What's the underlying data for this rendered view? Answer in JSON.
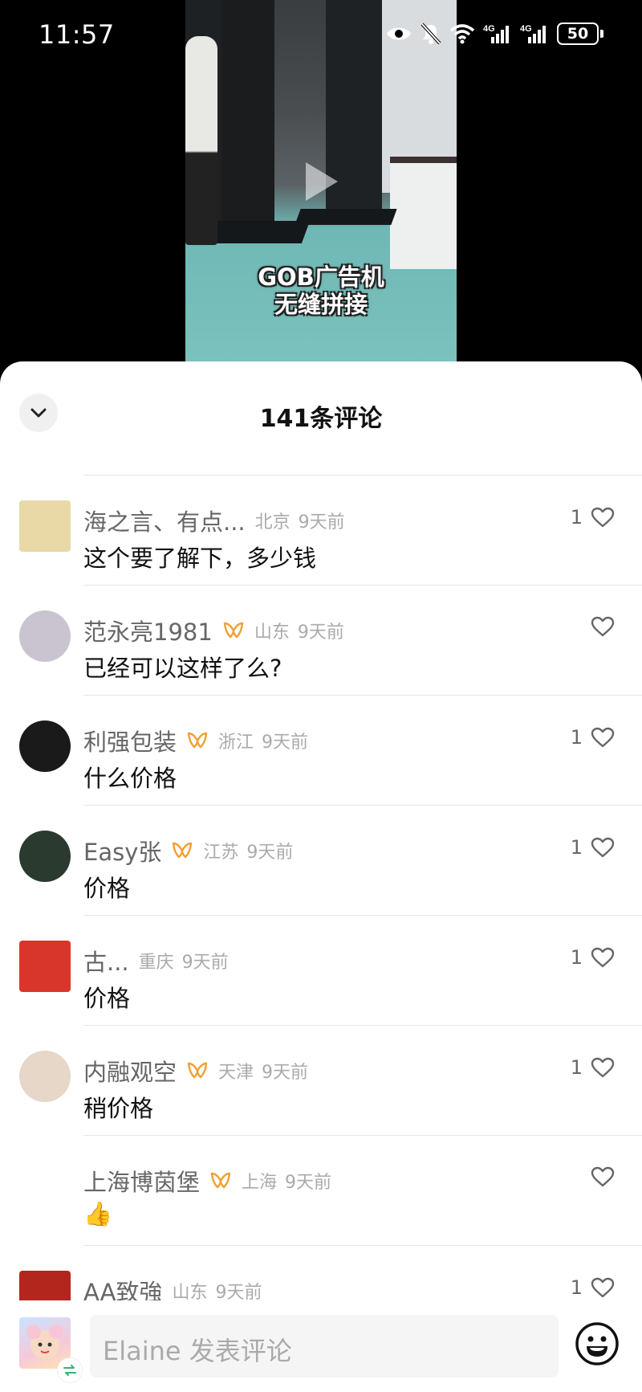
{
  "status_bar": {
    "time": "11:57",
    "network_1": "4G",
    "network_2": "4G",
    "battery": "50"
  },
  "video": {
    "caption_line1": "GOB广告机",
    "caption_line2": "无缝拼接"
  },
  "sheet": {
    "title": "141条评论"
  },
  "comments": [
    {
      "name": "海之言、有点...",
      "badge": false,
      "location": "北京",
      "time": "9天前",
      "text": "这个要了解下，多少钱",
      "likes": "1",
      "avatar_color": "#e9d9a7"
    },
    {
      "name": "范永亮1981",
      "badge": true,
      "location": "山东",
      "time": "9天前",
      "text": "已经可以这样了么?",
      "likes": "",
      "avatar_color": "#c9c4cf"
    },
    {
      "name": "利强包装",
      "badge": true,
      "location": "浙江",
      "time": "9天前",
      "text": "什么价格",
      "likes": "1",
      "avatar_color": "#1a1a1a"
    },
    {
      "name": "Easy张",
      "badge": true,
      "location": "江苏",
      "time": "9天前",
      "text": "价格",
      "likes": "1",
      "avatar_color": "#2b3a2e"
    },
    {
      "name": "古...",
      "badge": false,
      "location": "重庆",
      "time": "9天前",
      "text": "价格",
      "likes": "1",
      "avatar_color": "#d8362a"
    },
    {
      "name": "内融观空",
      "badge": true,
      "location": "天津",
      "time": "9天前",
      "text": "稍价格",
      "likes": "1",
      "avatar_color": "#e6d7c9"
    },
    {
      "name": "上海博茵堡",
      "badge": true,
      "location": "上海",
      "time": "9天前",
      "text": "👍",
      "likes": "",
      "avatar_color": "#ffffff"
    },
    {
      "name": "AA致強",
      "badge": false,
      "location": "山东",
      "time": "9天前",
      "text": "",
      "likes": "1",
      "avatar_color": "#b3261e"
    }
  ],
  "input": {
    "placeholder": "Elaine 发表评论"
  },
  "colors": {
    "badge": "#f0a030",
    "background": "#ffffff",
    "video_bg": "#000000"
  }
}
